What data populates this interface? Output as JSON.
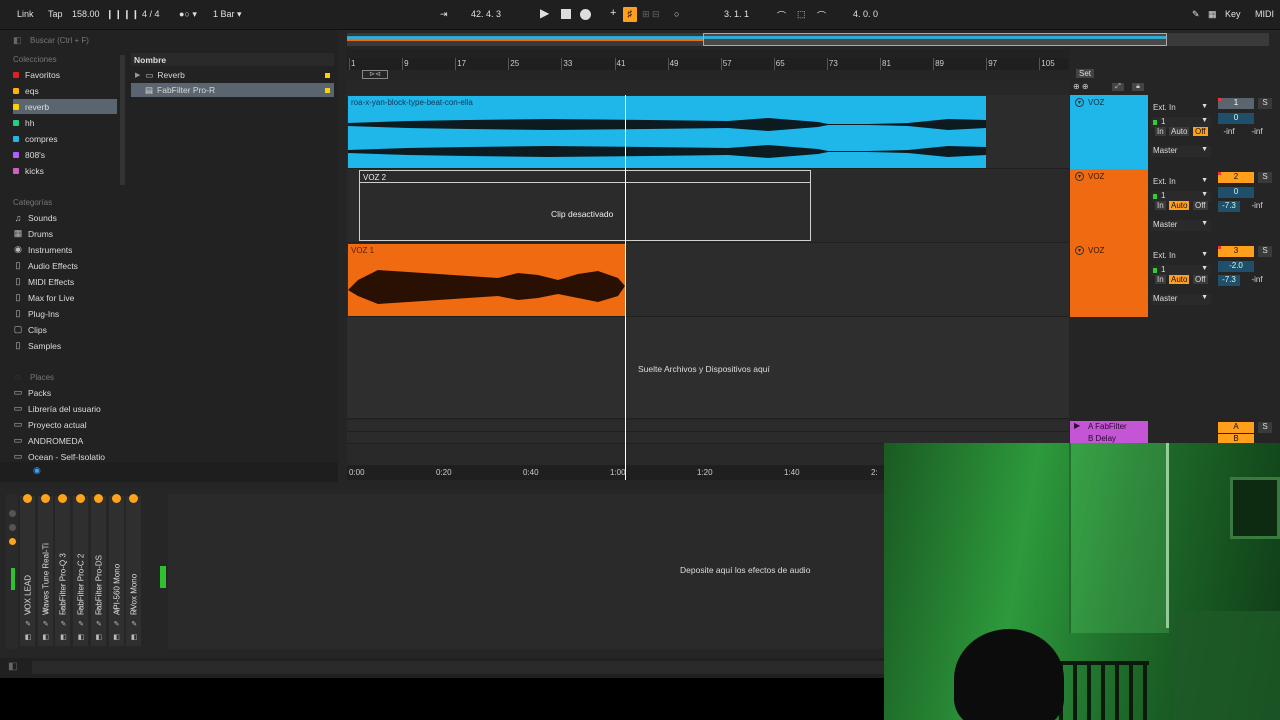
{
  "topbar": {
    "link": "Link",
    "tap": "Tap",
    "tempo": "158.00",
    "meter": "4 / 4",
    "quant": "1 Bar",
    "arr_position": "42.  4.  3",
    "loop_start": "3.  1.  1",
    "loop_length": "4.  0.  0",
    "key": "Key",
    "midi": "MIDI"
  },
  "browser": {
    "search_placeholder": "Buscar (Ctrl + F)",
    "collections_header": "Colecciones",
    "collections": [
      {
        "label": "Favoritos",
        "color": "#e02020"
      },
      {
        "label": "eqs",
        "color": "#ffb000"
      },
      {
        "label": "reverb",
        "color": "#ffd000"
      },
      {
        "label": "hh",
        "color": "#20d080"
      },
      {
        "label": "compres",
        "color": "#20b8e0"
      },
      {
        "label": "808's",
        "color": "#b060ff"
      },
      {
        "label": "kicks",
        "color": "#d060c0"
      }
    ],
    "categories_header": "Categorías",
    "categories": [
      "Sounds",
      "Drums",
      "Instruments",
      "Audio Effects",
      "MIDI Effects",
      "Max for Live",
      "Plug-Ins",
      "Clips",
      "Samples"
    ],
    "places_header": "Places",
    "places": [
      "Packs",
      "Librería del usuario",
      "Proyecto actual",
      "ANDROMEDA",
      "Ocean - Self-Isolatio"
    ],
    "column_header": "Nombre",
    "files": [
      "Reverb",
      "FabFilter Pro-R"
    ]
  },
  "arrangement": {
    "set_label": "Set",
    "ruler": [
      "1",
      "9",
      "17",
      "25",
      "33",
      "41",
      "49",
      "57",
      "65",
      "73",
      "81",
      "89",
      "97",
      "105"
    ],
    "clips": {
      "clip1": "roa-x-yan-block-type-beat-con-ella",
      "clip2": "VOZ 2",
      "clip2_status": "Clip desactivado",
      "clip3": "VOZ 1"
    },
    "drop_files": "Suelte Archivos y Dispositivos aquí",
    "timeline": [
      "0:00",
      "0:20",
      "0:40",
      "1:00",
      "1:20",
      "1:40",
      "2:"
    ]
  },
  "tracks": [
    {
      "name": "VOZ",
      "color": "#1fb6ea",
      "input": "Ext. In",
      "channel": "1",
      "monitor_in": "In",
      "monitor_auto": "Auto",
      "monitor_off": "Off",
      "output": "Master",
      "number": "1",
      "vol": "0",
      "pan": "-inf",
      "pan2": "-inf"
    },
    {
      "name": "VOZ",
      "color": "#ef6a10",
      "input": "Ext. In",
      "channel": "1",
      "monitor_in": "In",
      "monitor_auto": "Auto",
      "monitor_off": "Off",
      "output": "Master",
      "number": "2",
      "vol": "0",
      "pan": "-7.3",
      "pan2": "-inf"
    },
    {
      "name": "VOZ",
      "color": "#ef6a10",
      "input": "Ext. In",
      "channel": "1",
      "monitor_in": "In",
      "monitor_auto": "Auto",
      "monitor_off": "Off",
      "output": "Master",
      "number": "3",
      "vol": "-2.0",
      "pan": "-7.3",
      "pan2": "-inf"
    }
  ],
  "returns": [
    {
      "name": "A FabFilter",
      "letter": "A",
      "solo": "S"
    },
    {
      "name": "B Delay",
      "letter": "B",
      "solo": "S"
    }
  ],
  "device_chain": {
    "devices": [
      "VOX LEAD",
      "Waves Tune Real-Ti",
      "FabFilter Pro-Q 3",
      "FabFilter Pro-C 2",
      "FabFilter Pro-DS",
      "API-560 Mono",
      "RVox Mono"
    ],
    "drop_audio": "Deposite aquí los efectos de audio"
  },
  "colors": {
    "blue_clip": "#1fb6ea",
    "orange_clip": "#ef6a10",
    "accent": "#ffa31a"
  }
}
